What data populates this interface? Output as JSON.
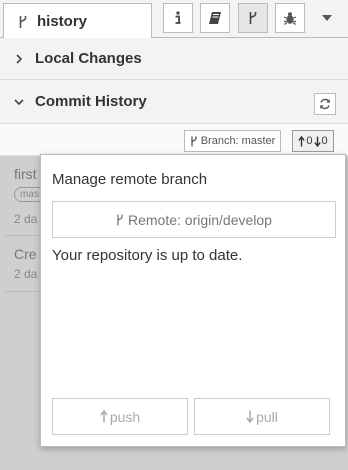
{
  "tab": {
    "label": "history",
    "icon": "branch-icon"
  },
  "toolbar": {
    "buttons": [
      {
        "icon": "info-icon",
        "active": false
      },
      {
        "icon": "book-icon",
        "active": false
      },
      {
        "icon": "branch-icon",
        "active": true
      },
      {
        "icon": "bug-icon",
        "active": false
      }
    ],
    "menu_icon": "caret-down-icon"
  },
  "sections": {
    "local_changes": {
      "label": "Local Changes",
      "expanded": false
    },
    "commit_history": {
      "label": "Commit History",
      "expanded": true,
      "refresh_icon": "refresh-icon"
    }
  },
  "commit_toolbar": {
    "branch_label": "Branch: master",
    "ahead": "0",
    "behind": "0"
  },
  "commits": [
    {
      "title": "first",
      "tag": "mas",
      "date": "2 da"
    },
    {
      "title": "Cre",
      "date": "2 da"
    }
  ],
  "popover": {
    "title": "Manage remote branch",
    "remote_label": "Remote: origin/develop",
    "status": "Your repository is up to date.",
    "push_label": "push",
    "pull_label": "pull"
  },
  "colors": {
    "border": "#bbbbbb",
    "header_bg": "#f3f3f3",
    "overlay": "#cfcfcf"
  }
}
